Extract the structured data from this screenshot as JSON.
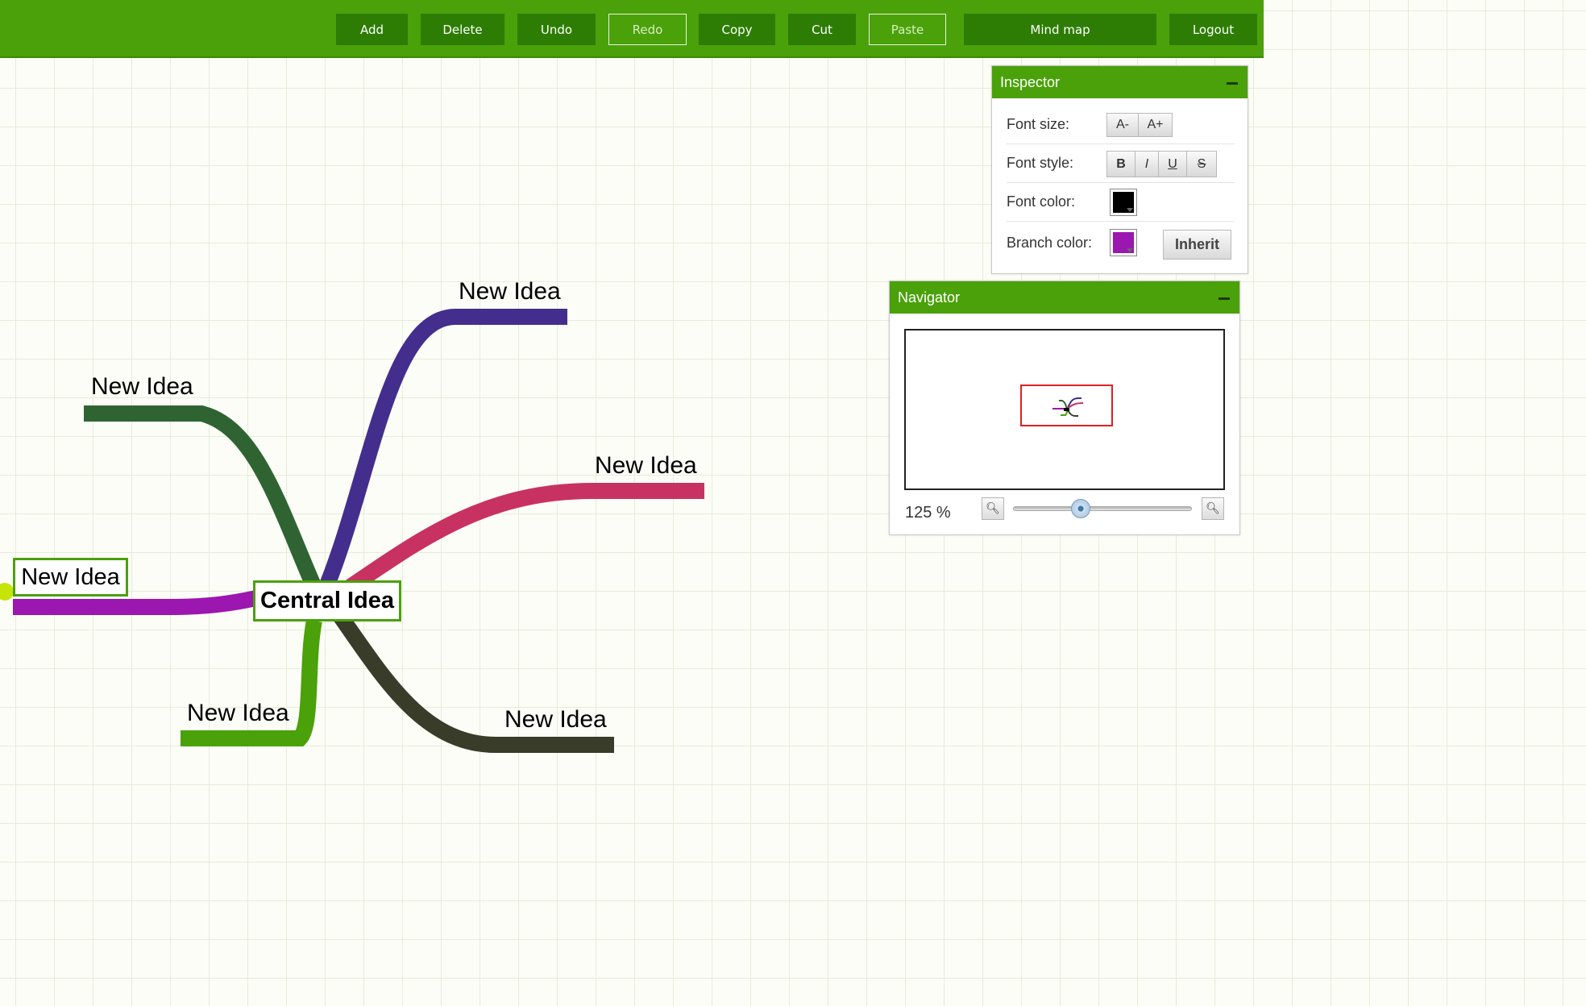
{
  "toolbar": {
    "add": "Add",
    "delete": "Delete",
    "undo": "Undo",
    "redo": "Redo",
    "copy": "Copy",
    "cut": "Cut",
    "paste": "Paste",
    "mindmap": "Mind map",
    "logout": "Logout"
  },
  "mindmap": {
    "central": "Central Idea",
    "branches": [
      {
        "label": "New Idea",
        "color": "#432e8e"
      },
      {
        "label": "New Idea",
        "color": "#2f6432"
      },
      {
        "label": "New Idea",
        "color": "#c83262"
      },
      {
        "label": "New Idea",
        "color": "#9c16b0"
      },
      {
        "label": "New Idea",
        "color": "#4aa10a"
      },
      {
        "label": "New Idea",
        "color": "#3a3c2a"
      }
    ]
  },
  "inspector": {
    "title": "Inspector",
    "font_size_label": "Font size:",
    "font_size_decrease": "A-",
    "font_size_increase": "A+",
    "font_style_label": "Font style:",
    "bold": "B",
    "italic": "I",
    "underline": "U",
    "strike": "S",
    "font_color_label": "Font color:",
    "font_color": "#000000",
    "branch_color_label": "Branch color:",
    "branch_color": "#9c16b0",
    "inherit": "Inherit"
  },
  "navigator": {
    "title": "Navigator",
    "zoom": "125 %",
    "zoom_fraction": 0.36
  },
  "colors": {
    "brand_green": "#4aa10a",
    "button_dark_green": "#2d7d04",
    "viewport_outline": "#e02020"
  }
}
